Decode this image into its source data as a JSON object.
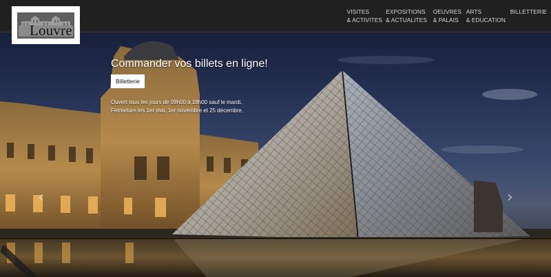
{
  "logo": {
    "text": "Louvre"
  },
  "nav": [
    {
      "line1": "Visites",
      "line2": "& Activites"
    },
    {
      "line1": "Expositions",
      "line2": "& Actualites"
    },
    {
      "line1": "Oeuvres",
      "line2": "& Palais"
    },
    {
      "line1": "Arts",
      "line2": "& Education"
    },
    {
      "line1": "Billetterie",
      "line2": ""
    }
  ],
  "hero": {
    "title": "Commander vos billets en ligne!",
    "button": "Billetterie",
    "line1": "Ouvert tous les jours de 09h00 à 18h00 sauf le mardi.",
    "line2": "Fermeture les 1er mai, 1er novembre et 25 décembre."
  },
  "carousel": {
    "prev_icon": "chevron-left-icon",
    "next_icon": "chevron-right-icon"
  },
  "colors": {
    "header_bg": "#202020",
    "nav_text": "#d8d8d8",
    "button_bg": "#ffffff"
  }
}
